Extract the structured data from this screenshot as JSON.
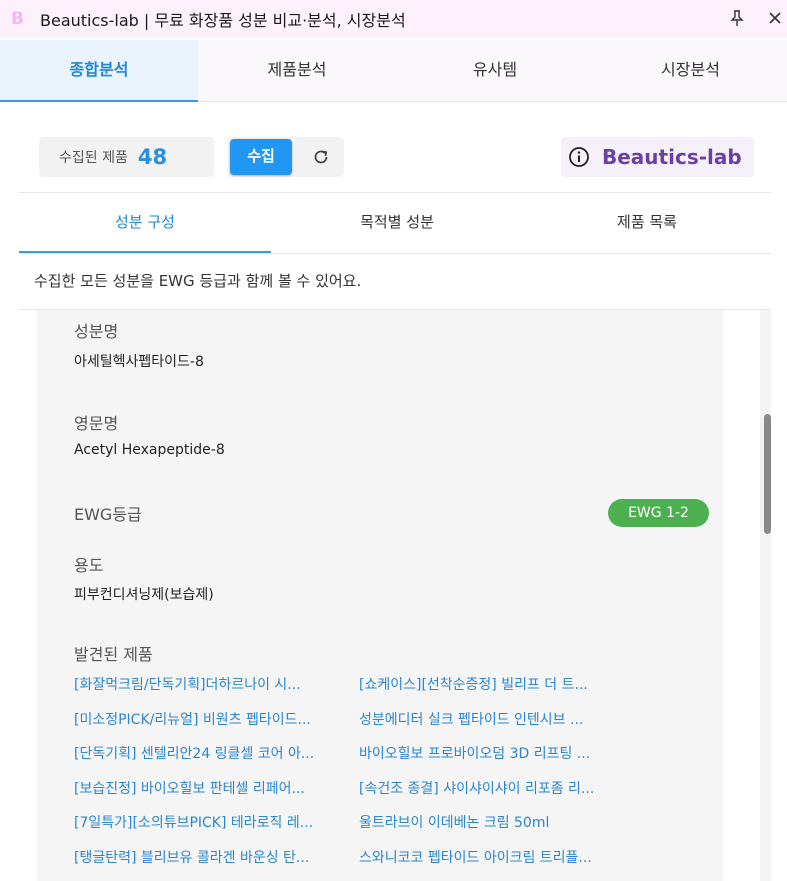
{
  "window": {
    "title": "Beautics-lab | 무료 화장품 성분 비교·분석, 시장분석",
    "app_icon_letter": "B"
  },
  "main_tabs": [
    {
      "label": "종합분석",
      "active": true
    },
    {
      "label": "제품분석",
      "active": false
    },
    {
      "label": "유사템",
      "active": false
    },
    {
      "label": "시장분석",
      "active": false
    }
  ],
  "toolbar": {
    "collected_label": "수집된 제품",
    "collected_count": "48",
    "collect_button": "수집",
    "brand_name": "Beautics-lab"
  },
  "sub_tabs": [
    {
      "label": "성분 구성",
      "active": true
    },
    {
      "label": "목적별 성분",
      "active": false
    },
    {
      "label": "제품 목록",
      "active": false
    }
  ],
  "description": "수집한 모든 성분을 EWG 등급과 함께 볼 수 있어요.",
  "ingredient": {
    "name_label": "성분명",
    "name_value": "아세틸헥사펩타이드-8",
    "english_label": "영문명",
    "english_value": "Acetyl Hexapeptide-8",
    "ewg_label": "EWG등급",
    "ewg_value": "EWG 1-2",
    "usage_label": "용도",
    "usage_value": "피부컨디셔닝제(보습제)",
    "products_label": "발견된 제품",
    "products": [
      "[화잘먹크림/단독기획]더하르나이 시...",
      "[쇼케이스][선착순증정] 빌리프 더 트...",
      "[미소정PICK/리뉴얼] 비원츠 펩타이드...",
      "성분에디터 실크 펩타이드 인텐시브 ...",
      "[단독기획] 센텔리안24 링클셀 코어 아...",
      "바이오힐보 프로바이오덤 3D 리프팅 ...",
      "[보습진정] 바이오힐보 판테셀 리페어...",
      "[속건조 종결] 샤이샤이샤이 리포좀 리...",
      "[7일특가][소의튜브PICK] 테라로직 레...",
      "울트라브이 이데베논 크림 50ml",
      "[탱글탄력] 블리브유 콜라겐 바운싱 탄...",
      "스와니코코 펩타이드 아이크림 트리플..."
    ]
  },
  "colors": {
    "accent_blue": "#2196f3",
    "link_blue": "#2a86d0",
    "brand_purple": "#6a3fa6",
    "ewg_green": "#4caf50",
    "titlebar_bg": "#fdf1fb"
  },
  "icons": {
    "pin": "pin-icon",
    "close": "close-icon",
    "refresh": "refresh-icon",
    "info": "info-icon"
  }
}
